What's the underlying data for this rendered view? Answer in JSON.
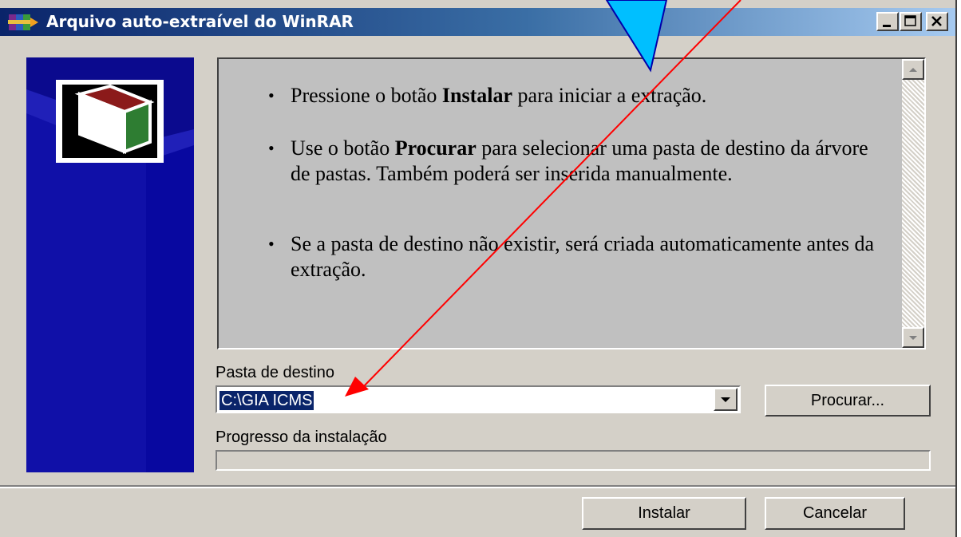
{
  "window": {
    "title": "Arquivo auto-extraível do WinRAR"
  },
  "info": {
    "items": [
      {
        "before": "Pressione o botão ",
        "bold": "Instalar",
        "after": " para iniciar a extração."
      },
      {
        "before": "Use o botão ",
        "bold": "Procurar",
        "after": " para selecionar uma pasta de destino da árvore de pastas. Também poderá ser inserida manualmente."
      },
      {
        "before": "Se a pasta de destino não existir, será criada automaticamente antes da extração.",
        "bold": "",
        "after": ""
      }
    ]
  },
  "destination": {
    "label": "Pasta de destino",
    "value": "C:\\GIA ICMS",
    "browse_label": "Procurar..."
  },
  "progress": {
    "label": "Progresso da instalação",
    "fraction": 0
  },
  "buttons": {
    "install_label": "Instalar",
    "cancel_label": "Cancelar"
  },
  "colors": {
    "banner": "#0b0a8e",
    "annotation_arrow": "#ff0000",
    "callout": "#00bfff"
  }
}
